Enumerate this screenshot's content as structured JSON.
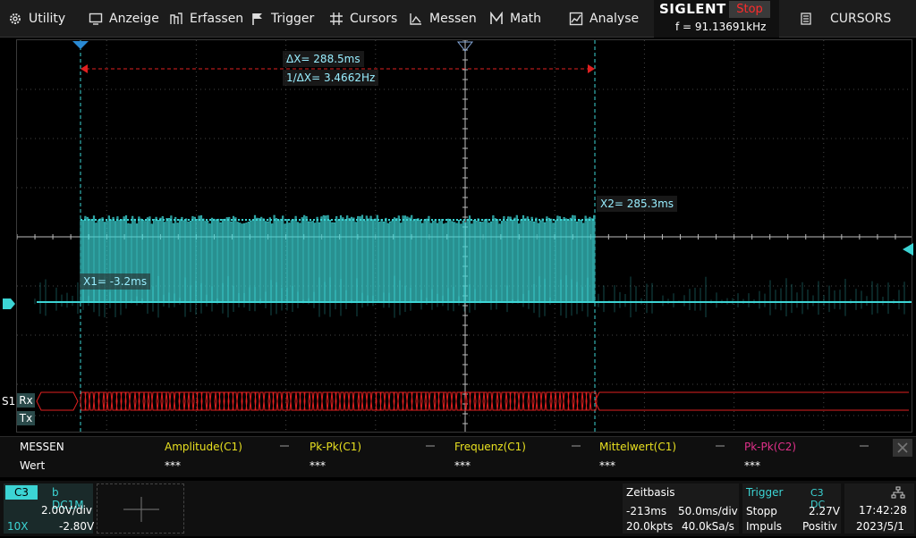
{
  "menu": {
    "items": [
      {
        "label": "Utility",
        "icon": "gear-icon"
      },
      {
        "label": "Anzeige",
        "icon": "display-icon"
      },
      {
        "label": "Erfassen",
        "icon": "acquire-icon"
      },
      {
        "label": "Trigger",
        "icon": "flag-icon"
      },
      {
        "label": "Cursors",
        "icon": "cursors-icon"
      },
      {
        "label": "Messen",
        "icon": "measure-icon"
      },
      {
        "label": "Math",
        "icon": "math-icon"
      },
      {
        "label": "Analyse",
        "icon": "analyse-icon"
      }
    ]
  },
  "brand": {
    "logo": "SIGLENT",
    "state": "Stop",
    "freq": "f = 91.13691kHz"
  },
  "right_button": {
    "label": "CURSORS",
    "icon": "list-icon"
  },
  "cursors": {
    "dx": "ΔX= 288.5ms",
    "inv_dx": "1/ΔX= 3.4662Hz",
    "x1": "X1= -3.2ms",
    "x2": "X2= 285.3ms"
  },
  "serial": {
    "bus": "S1",
    "rx": "Rx",
    "tx": "Tx"
  },
  "measure": {
    "title": "MESSEN",
    "row_label": "Wert",
    "items": [
      {
        "name": "Amplitude(C1)",
        "value": "***",
        "color": "#e8e020"
      },
      {
        "name": "Pk-Pk(C1)",
        "value": "***",
        "color": "#e8e020"
      },
      {
        "name": "Frequenz(C1)",
        "value": "***",
        "color": "#e8e020"
      },
      {
        "name": "Mittelwert(C1)",
        "value": "***",
        "color": "#e8e020"
      },
      {
        "name": "Pk-Pk(C2)",
        "value": "***",
        "color": "#e0308a"
      }
    ]
  },
  "channel": {
    "name": "C3",
    "coupling": "b DC1M",
    "scale": "2.00V/div",
    "probe": "10X",
    "offset": "-2.80V"
  },
  "timebase": {
    "title": "Zeitbasis",
    "delay": "-213ms",
    "scale": "50.0ms/div",
    "points": "20.0kpts",
    "rate": "40.0kSa/s"
  },
  "trigger": {
    "title": "Trigger",
    "source": "C3 DC",
    "mode": "Stopp",
    "level": "2.27V",
    "type": "Impuls",
    "polarity": "Positiv"
  },
  "clock": {
    "time": "17:42:28",
    "date": "2023/5/1"
  },
  "colors": {
    "cyan": "#3cd4d4",
    "red": "#e02020",
    "yellow": "#e8e020",
    "pink": "#e0308a"
  }
}
